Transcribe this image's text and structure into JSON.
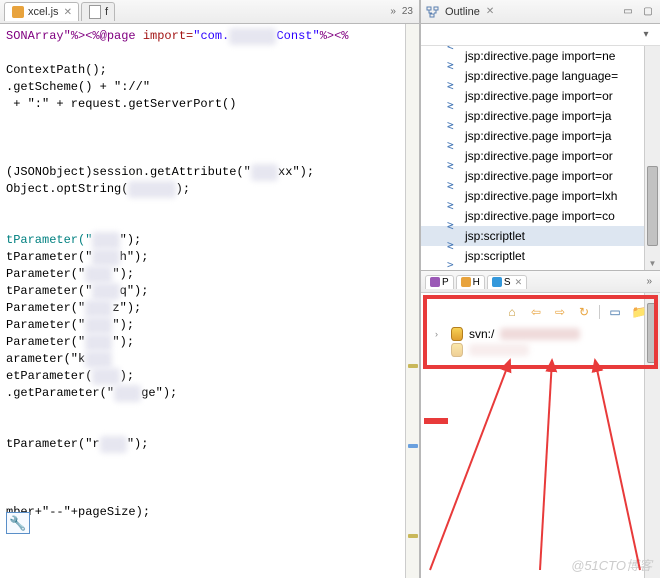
{
  "tabs": {
    "t1_label": "xcel.js",
    "t2_label": "f",
    "overflow_count": "23"
  },
  "code": {
    "line1_pre": "SONArray\"",
    "line1_tagclose": "%>",
    "line1_tagopen": "<%@page ",
    "line1_import": "import=",
    "line1_strA": "\"com.",
    "line1_strB": "Const\"",
    "line1_tagend": "%><%",
    "l2": "ContextPath();",
    "l3": ".getScheme() + \"://\"",
    "l4": " + \":\" + request.getServerPort()",
    "l5a": "(JSONObject)session.getAttribute(\"",
    "l5b": "xx\");",
    "l6": "Object.optString(",
    "l6b": ");",
    "p1a": "tParameter(\"",
    "p1b": "\");",
    "p2a": "tParameter(\"",
    "p2b": "h\");",
    "p3a": "Parameter(\"",
    "p3b": "\");",
    "p4a": "tParameter(\"",
    "p4b": "q\");",
    "p5a": "Parameter(\"",
    "p5b": "z\");",
    "p6a": "Parameter(\"",
    "p6b": "\");",
    "p7a": "Parameter(\"",
    "p7b": "\");",
    "p8a": "arameter(\"k",
    "p8b": "",
    "p9a": "etParameter(",
    "p9b": ");",
    "p10a": ".getParameter(\"",
    "p10b": "ge\");",
    "p11a": "tParameter(\"r",
    "p11b": "\");",
    "last": "mber+\"--\"+pageSize);"
  },
  "outline": {
    "title": "Outline",
    "items": [
      "jsp:directive.page import=ne",
      "jsp:directive.page language=",
      "jsp:directive.page import=or",
      "jsp:directive.page import=ja",
      "jsp:directive.page import=ja",
      "jsp:directive.page import=or",
      "jsp:directive.page import=or",
      "jsp:directive.page import=lxh",
      "jsp:directive.page import=co",
      "jsp:scriptlet",
      "jsp:scriptlet"
    ],
    "selected_index": 9
  },
  "bottom_tabs": {
    "p": "P",
    "h": "H",
    "s": "S"
  },
  "svn": {
    "label": "svn:/"
  },
  "watermark": "@51CTO博客"
}
